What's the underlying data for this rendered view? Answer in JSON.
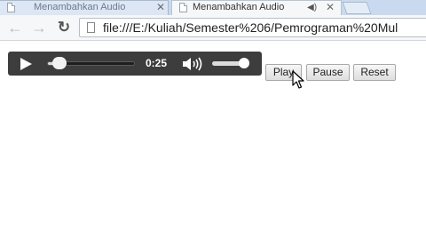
{
  "browser": {
    "tabs": [
      {
        "title": "Menambahkan Audio",
        "active": false,
        "has_close": true
      },
      {
        "title": "Menambahkan Audio",
        "active": true,
        "has_close": true,
        "audio_icon": "speaker-small-icon"
      }
    ],
    "url": "file:///E:/Kuliah/Semester%206/Pemrograman%20Mul"
  },
  "player": {
    "time": "0:25",
    "progress": 0.14,
    "volume": 0.9,
    "icons": {
      "play": "play-icon",
      "speaker": "volume-icon"
    }
  },
  "controls": {
    "play": "Play",
    "pause": "Pause",
    "reset": "Reset"
  },
  "colors": {
    "player_bg": "#3d3d3d",
    "tabstrip_bg": "#c9d9ef",
    "button_border": "#a9a9a9"
  }
}
